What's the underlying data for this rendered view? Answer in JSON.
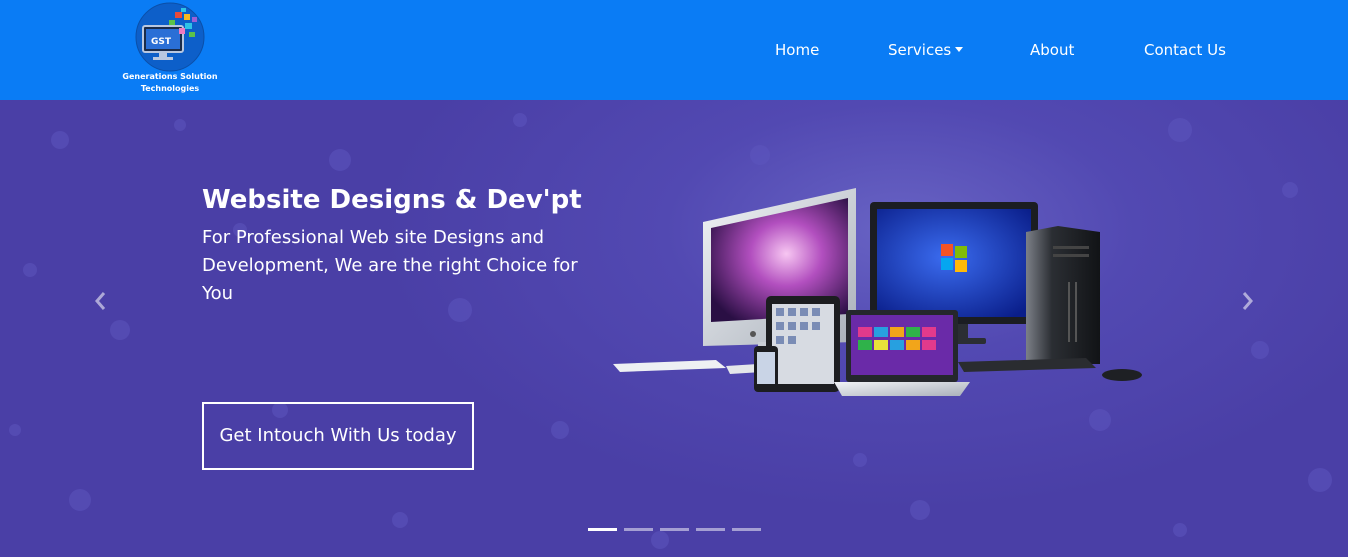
{
  "brand": {
    "logo_text": "GST",
    "name_line1": "Generations Solution",
    "name_line2": "Technologies",
    "icon": "computer-monitor-logo-icon"
  },
  "nav": {
    "items": [
      {
        "label": "Home"
      },
      {
        "label": "Services",
        "has_dropdown": true
      },
      {
        "label": "About"
      },
      {
        "label": "Contact Us"
      }
    ]
  },
  "carousel": {
    "slide": {
      "title": "Website Designs & Dev'pt",
      "text": "For Professional Web site Designs and Development, We are the right Choice for You",
      "cta_label": "Get Intouch With Us today"
    },
    "prev_icon": "chevron-left-icon",
    "next_icon": "chevron-right-icon",
    "indicator_count": 5,
    "active_index": 0
  },
  "colors": {
    "navbar": "#0a7cf5",
    "hero_background": "#4a3fa6",
    "text": "#ffffff"
  }
}
